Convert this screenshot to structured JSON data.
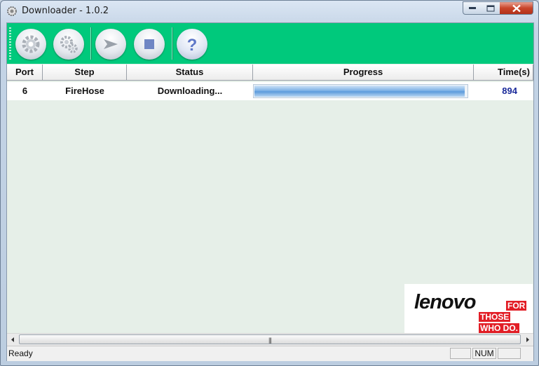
{
  "window": {
    "title": "Downloader - 1.0.2"
  },
  "toolbar": {
    "buttons": [
      {
        "icon": "gear-icon"
      },
      {
        "icon": "gears-icon"
      },
      {
        "icon": "play-arrow-icon"
      },
      {
        "icon": "stop-icon"
      },
      {
        "icon": "help-icon",
        "glyph": "?"
      }
    ],
    "bg_color": "#00c97c"
  },
  "table": {
    "columns": [
      "Port",
      "Step",
      "Status",
      "Progress",
      "Time(s)"
    ],
    "rows": [
      {
        "port": "6",
        "step": "FireHose",
        "status": "Downloading...",
        "progress": 0.99,
        "time": "894"
      }
    ]
  },
  "logo": {
    "word": "lenovo",
    "line1": "FOR",
    "line2": "THOSE",
    "line3": "WHO DO."
  },
  "statusbar": {
    "text": "Ready",
    "num": "NUM"
  }
}
